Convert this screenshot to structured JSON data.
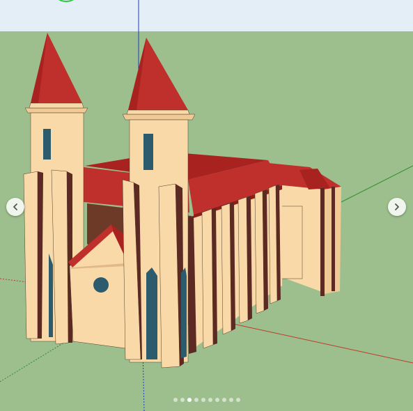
{
  "viewer": {
    "sky_color": "#e3eef7",
    "ground_color": "#9dbf8e",
    "model_colors": {
      "wall": "#f9d9a8",
      "wall_shade": "#f0c994",
      "roof": "#bf2f2b",
      "roof_shade": "#a8231f",
      "buttress_side": "#5c2a22",
      "window": "#2c5b6e"
    },
    "axes": {
      "red": "#c0392b",
      "green": "#2e8b2e",
      "blue": "#1f3bbf"
    }
  },
  "carousel": {
    "prev_icon": "chevron-left-icon",
    "next_icon": "chevron-right-icon",
    "page_count": 10,
    "current_page": 3
  }
}
